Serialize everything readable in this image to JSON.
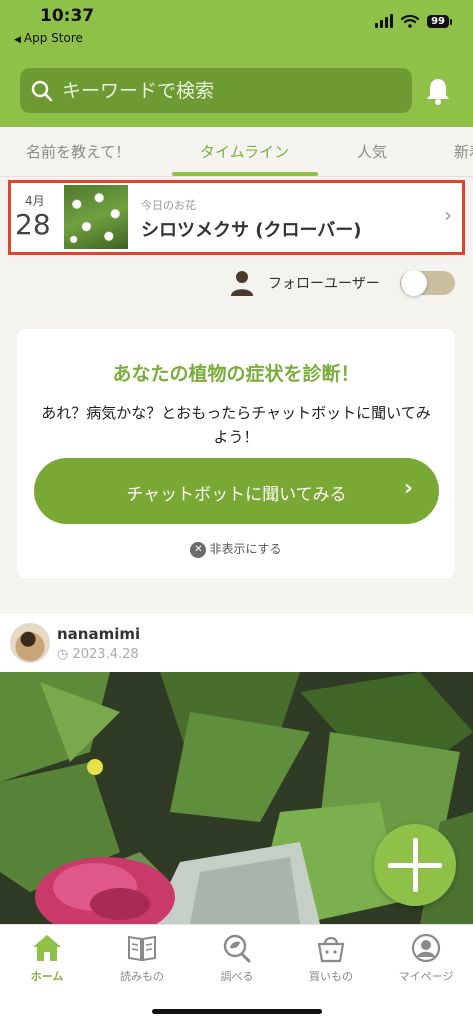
{
  "status_bar": {
    "time": "10:37",
    "back_app": "App Store",
    "battery": "99"
  },
  "search": {
    "placeholder": "キーワードで検索"
  },
  "tabs": [
    {
      "label": "名前を教えて！"
    },
    {
      "label": "タイムライン",
      "active": true
    },
    {
      "label": "人気"
    },
    {
      "label": "新着"
    }
  ],
  "flower_of_day": {
    "month": "4月",
    "day": "28",
    "caption": "今日のお花",
    "name": "シロツメクサ (クローバー)"
  },
  "follow_toggle": {
    "label": "フォローユーザー",
    "on": false
  },
  "diagnosis_card": {
    "title": "あなたの植物の症状を診断！",
    "body": "あれ？病気かな？とおもったらチャットボットに聞いてみよう！",
    "button_label": "チャットボットに聞いてみる",
    "hide_label": "非表示にする"
  },
  "post": {
    "username": "nanamimi",
    "date": "2023.4.28"
  },
  "bottom_nav": [
    {
      "label": "ホーム",
      "icon": "home-icon",
      "active": true
    },
    {
      "label": "読みもの",
      "icon": "book-icon"
    },
    {
      "label": "調べる",
      "icon": "search-leaf-icon"
    },
    {
      "label": "買いもの",
      "icon": "basket-icon"
    },
    {
      "label": "マイページ",
      "icon": "user-icon"
    }
  ],
  "colors": {
    "brand_green": "#8fc149",
    "accent_green": "#7aae3c",
    "highlight_red": "#e0442b"
  }
}
